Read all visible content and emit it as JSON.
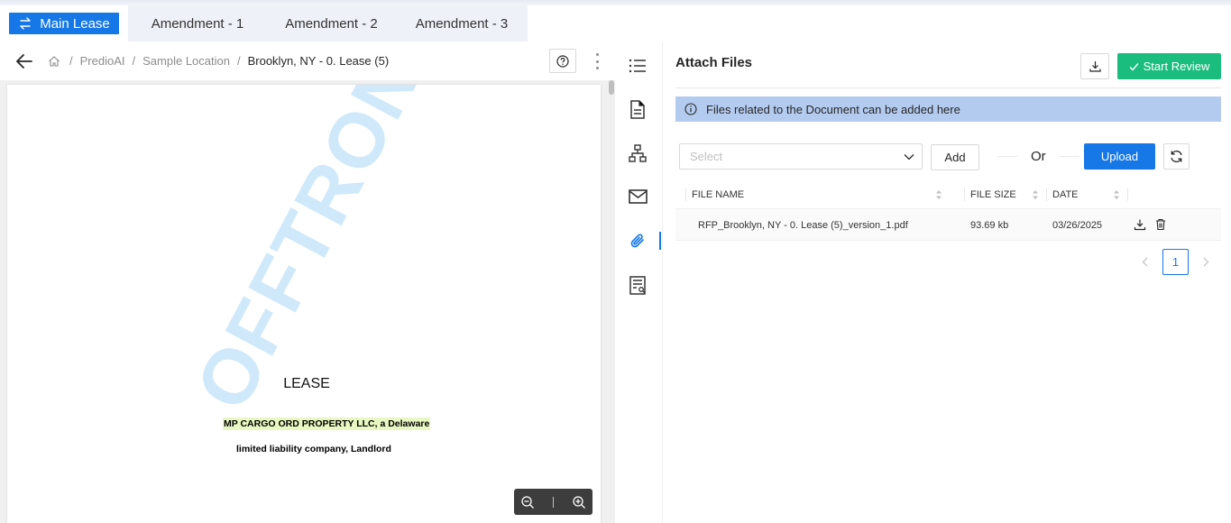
{
  "tabs": [
    {
      "label": "Main Lease",
      "active": true,
      "icon": "swap-arrows-icon"
    },
    {
      "label": "Amendment - 1",
      "active": false
    },
    {
      "label": "Amendment - 2",
      "active": false
    },
    {
      "label": "Amendment - 3",
      "active": false
    }
  ],
  "breadcrumb": {
    "items": [
      "PredioAI",
      "Sample Location",
      "Brooklyn, NY - 0. Lease (5)"
    ],
    "separator": "/"
  },
  "document": {
    "watermark": "OFFTRON",
    "title": "LEASE",
    "line1": "MP CARGO ORD PROPERTY LLC, a Delaware",
    "line2": "limited liability company, Landlord"
  },
  "rail": {
    "icons": [
      "list-icon",
      "document-icon",
      "hierarchy-icon",
      "mail-icon",
      "attachment-icon",
      "report-icon"
    ],
    "active": "attachment-icon"
  },
  "panel": {
    "title": "Attach Files",
    "start_review_label": "Start Review",
    "info_text": "Files related to the Document can be added here",
    "select_placeholder": "Select",
    "add_label": "Add",
    "or_label": "Or",
    "upload_label": "Upload"
  },
  "table": {
    "columns": [
      "FILE NAME",
      "FILE SIZE",
      "DATE"
    ],
    "rows": [
      {
        "file_name": "RFP_Brooklyn, NY - 0. Lease (5)_version_1.pdf",
        "file_size": "93.69 kb",
        "date": "03/26/2025"
      }
    ]
  },
  "pagination": {
    "current_page": "1"
  },
  "colors": {
    "accent": "#1677e6",
    "success": "#1bbd7e",
    "info_bg": "#b4cbf0"
  }
}
